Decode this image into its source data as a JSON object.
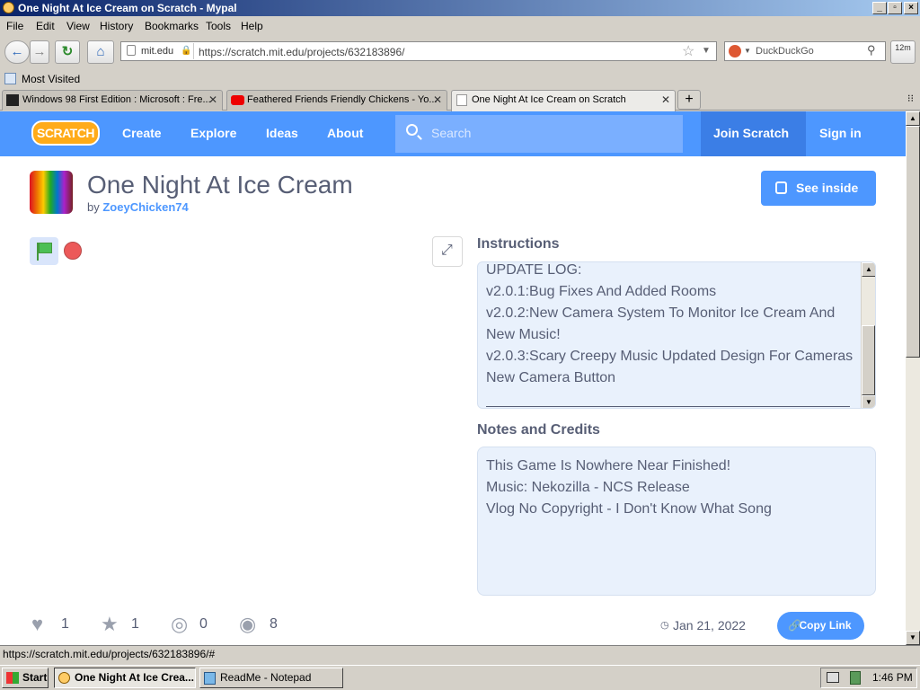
{
  "window": {
    "title": "One Night At Ice Cream on Scratch - Mypal"
  },
  "menu": [
    "File",
    "Edit",
    "View",
    "History",
    "Bookmarks",
    "Tools",
    "Help"
  ],
  "nav": {
    "site_identity": "mit.edu",
    "url": "https://scratch.mit.edu/projects/632183896/",
    "search_engine": "DuckDuckGo",
    "zoom": "12m"
  },
  "bookmarks": {
    "most_visited": "Most Visited"
  },
  "tabs": [
    {
      "label": "Windows 98 First Edition : Microsoft : Fre...",
      "active": false
    },
    {
      "label": "Feathered Friends Friendly Chickens - Yo...",
      "active": false
    },
    {
      "label": "One Night At Ice Cream on Scratch",
      "active": true
    }
  ],
  "scratch_nav": {
    "logo": "SCRATCH",
    "links": [
      "Create",
      "Explore",
      "Ideas",
      "About"
    ],
    "search_placeholder": "Search",
    "join": "Join Scratch",
    "signin": "Sign in"
  },
  "project": {
    "title": "One Night At Ice Cream",
    "by_prefix": "by",
    "author": "ZoeyChicken74",
    "see_inside": "See inside"
  },
  "instructions": {
    "heading": "Instructions",
    "lines": [
      "UPDATE LOG:",
      "v2.0.1:Bug Fixes And Added Rooms",
      "v2.0.2:New Camera System To Monitor Ice Cream And",
      "New Music!",
      "v2.0.3:Scary Creepy Music Updated Design For Cameras",
      "New Camera Button"
    ]
  },
  "notes": {
    "heading": "Notes and Credits",
    "lines": [
      "This Game Is Nowhere Near Finished!",
      "Music: Nekozilla - NCS Release",
      "Vlog No Copyright - I Don't Know What Song"
    ]
  },
  "stats": {
    "loves": "1",
    "favorites": "1",
    "remixes": "0",
    "views": "8"
  },
  "shared_date": "Jan 21, 2022",
  "copy_link": "Copy Link",
  "status_text": "https://scratch.mit.edu/projects/632183896/#",
  "taskbar": {
    "start": "Start",
    "items": [
      "One Night At Ice Crea...",
      "ReadMe - Notepad"
    ],
    "clock": "1:46 PM"
  },
  "colors": {
    "scratch_blue": "#4d97ff",
    "win_title": "#0a246a",
    "stop_red": "#ec5959"
  }
}
